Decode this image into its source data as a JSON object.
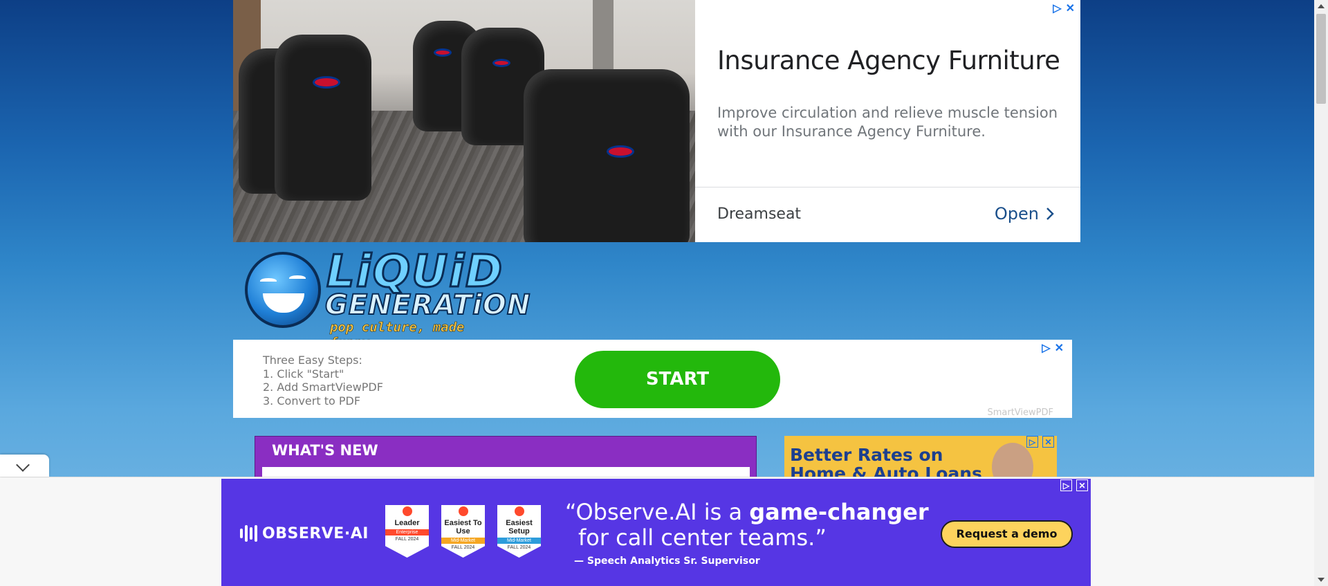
{
  "top_ad": {
    "headline": "Insurance Agency Furniture",
    "description": "Improve circulation and relieve muscle tension with our Insurance Agency Furniture.",
    "brand": "Dreamseat",
    "cta": "Open",
    "adchoices_icon": "play-triangle-icon",
    "close_icon": "close-icon"
  },
  "logo": {
    "line1": "LiQUiD",
    "line2": "GENERATiON",
    "tagline": "pop culture, made funny."
  },
  "mid_ad": {
    "steps": [
      "Three Easy Steps:",
      "1. Click \"Start\"",
      "2. Add SmartViewPDF",
      "3. Convert to PDF"
    ],
    "button": "START",
    "sponsor": "SmartViewPDF"
  },
  "whats_new": {
    "title": "WHAT'S NEW"
  },
  "side_ad": {
    "line1": "Better Rates on",
    "line2": "Home & Auto Loans"
  },
  "bottom_ad": {
    "brand": "OBSERVE·AI",
    "badges": [
      {
        "title": "Leader",
        "ribbon": "Enterprise",
        "ribbon_color": "#ff492c",
        "season": "FALL 2024"
      },
      {
        "title": "Easiest To Use",
        "ribbon": "Mid-Market",
        "ribbon_color": "#f5a623",
        "season": "FALL 2024"
      },
      {
        "title": "Easiest Setup",
        "ribbon": "Mid-Market",
        "ribbon_color": "#2d9cdb",
        "season": "FALL 2024"
      }
    ],
    "quote_open": "“",
    "quote_part1": "Observe.AI is a ",
    "quote_bold": "game-changer",
    "quote_part2": "for call center teams.”",
    "attribution": "— Speech Analytics Sr. Supervisor",
    "cta": "Request a demo"
  },
  "colors": {
    "bottom_ad_bg": "#5636e4",
    "start_green": "#23b80c",
    "whats_new_purple": "#8a2ec2",
    "side_ad_yellow": "#f5c341"
  }
}
